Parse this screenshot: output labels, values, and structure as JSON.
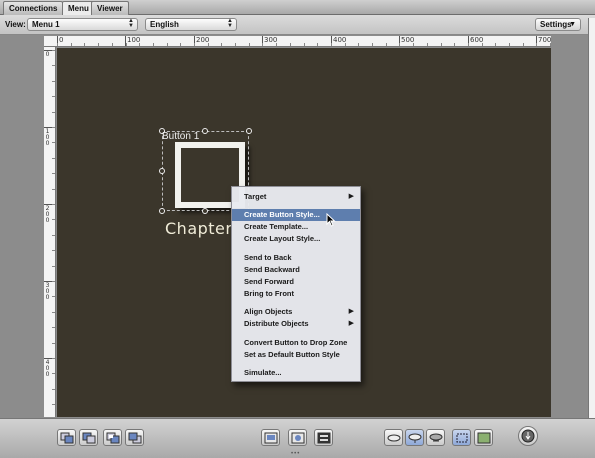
{
  "tabs": [
    {
      "label": "Connections",
      "active": false
    },
    {
      "label": "Menu",
      "active": true
    },
    {
      "label": "Viewer",
      "active": false
    }
  ],
  "toolbar": {
    "view_label": "View:",
    "view_value": "Menu 1",
    "language_value": "English",
    "settings_label": "Settings"
  },
  "rulers": {
    "top": [
      "0",
      "100",
      "200",
      "300",
      "400",
      "500",
      "600",
      "700"
    ],
    "left": [
      "0",
      "100",
      "200",
      "300",
      "400"
    ]
  },
  "canvas": {
    "button_label": "Button 1",
    "chapter_text": "Chapter",
    "background_color": "#3b362b"
  },
  "context_menu": {
    "highlight_color": "#5e7eae",
    "items": [
      {
        "label": "Target",
        "submenu": true
      },
      {
        "label": "Create Button Style...",
        "highlighted": true
      },
      {
        "label": "Create Template..."
      },
      {
        "label": "Create Layout Style..."
      },
      {
        "label": "Send to Back"
      },
      {
        "label": "Send Backward"
      },
      {
        "label": "Send Forward"
      },
      {
        "label": "Bring to Front"
      },
      {
        "label": "Align Objects",
        "submenu": true
      },
      {
        "label": "Distribute Objects",
        "submenu": true
      },
      {
        "label": "Convert Button to Drop Zone"
      },
      {
        "label": "Set as Default Button Style"
      },
      {
        "label": "Simulate..."
      }
    ]
  },
  "bottom_toolbar": {
    "buttons": [
      "send-to-back-icon",
      "send-backward-icon",
      "bring-forward-icon",
      "bring-to-front-icon",
      "add-submenu-icon",
      "add-button-icon",
      "add-text-icon",
      "show-standard-icon",
      "show-selected-icon",
      "show-activated-icon",
      "title-safe-icon",
      "display-background-icon",
      "simulator-icon"
    ]
  }
}
